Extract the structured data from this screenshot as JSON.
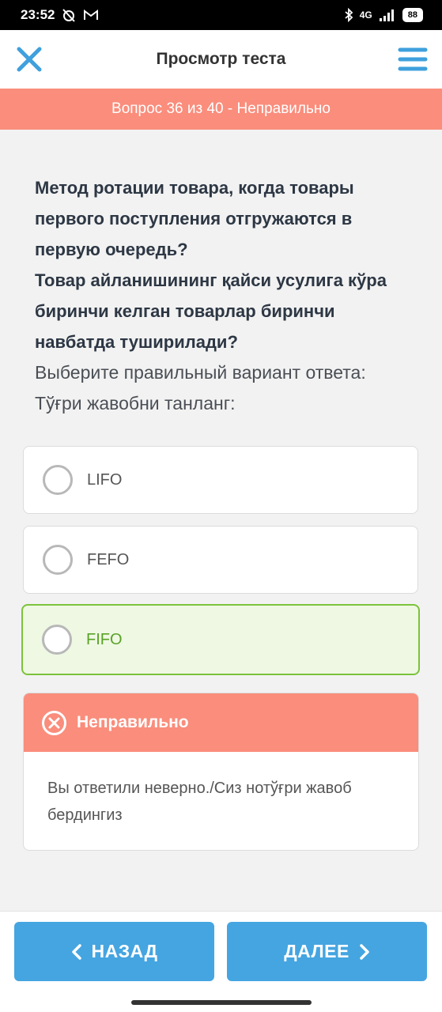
{
  "status_bar": {
    "time": "23:52",
    "network": "4G",
    "battery": "88"
  },
  "app_bar": {
    "title": "Просмотр теста"
  },
  "banner": {
    "text": "Вопрос 36 из 40 - Неправильно"
  },
  "question": {
    "line_ru": "Метод ротации товара, когда товары первого поступления отгружаются в первую очередь?",
    "line_uz": "Товар айланишининг қайси усулига кўра биринчи келган товарлар биринчи навбатда туширилади?",
    "instruction_ru": "Выберите правильный вариант ответа:",
    "instruction_uz": "Тўғри жавобни танланг:"
  },
  "options": [
    {
      "label": "LIFO",
      "state": "unselected"
    },
    {
      "label": "FEFO",
      "state": "unselected"
    },
    {
      "label": "FIFO",
      "state": "correct"
    }
  ],
  "feedback": {
    "title": "Неправильно",
    "message": "Вы ответили неверно./Сиз нотўғри жавоб бердингиз"
  },
  "navigation": {
    "back_label": "НАЗАД",
    "next_label": "ДАЛЕЕ"
  },
  "colors": {
    "accent_blue": "#45a5e1",
    "error_salmon": "#fa8d7c",
    "correct_green": "#7cc33c"
  },
  "icons": {
    "close": "close-icon",
    "menu": "menu-icon",
    "error": "error-circle-x-icon",
    "back": "chevron-left-icon",
    "next": "chevron-right-icon"
  }
}
